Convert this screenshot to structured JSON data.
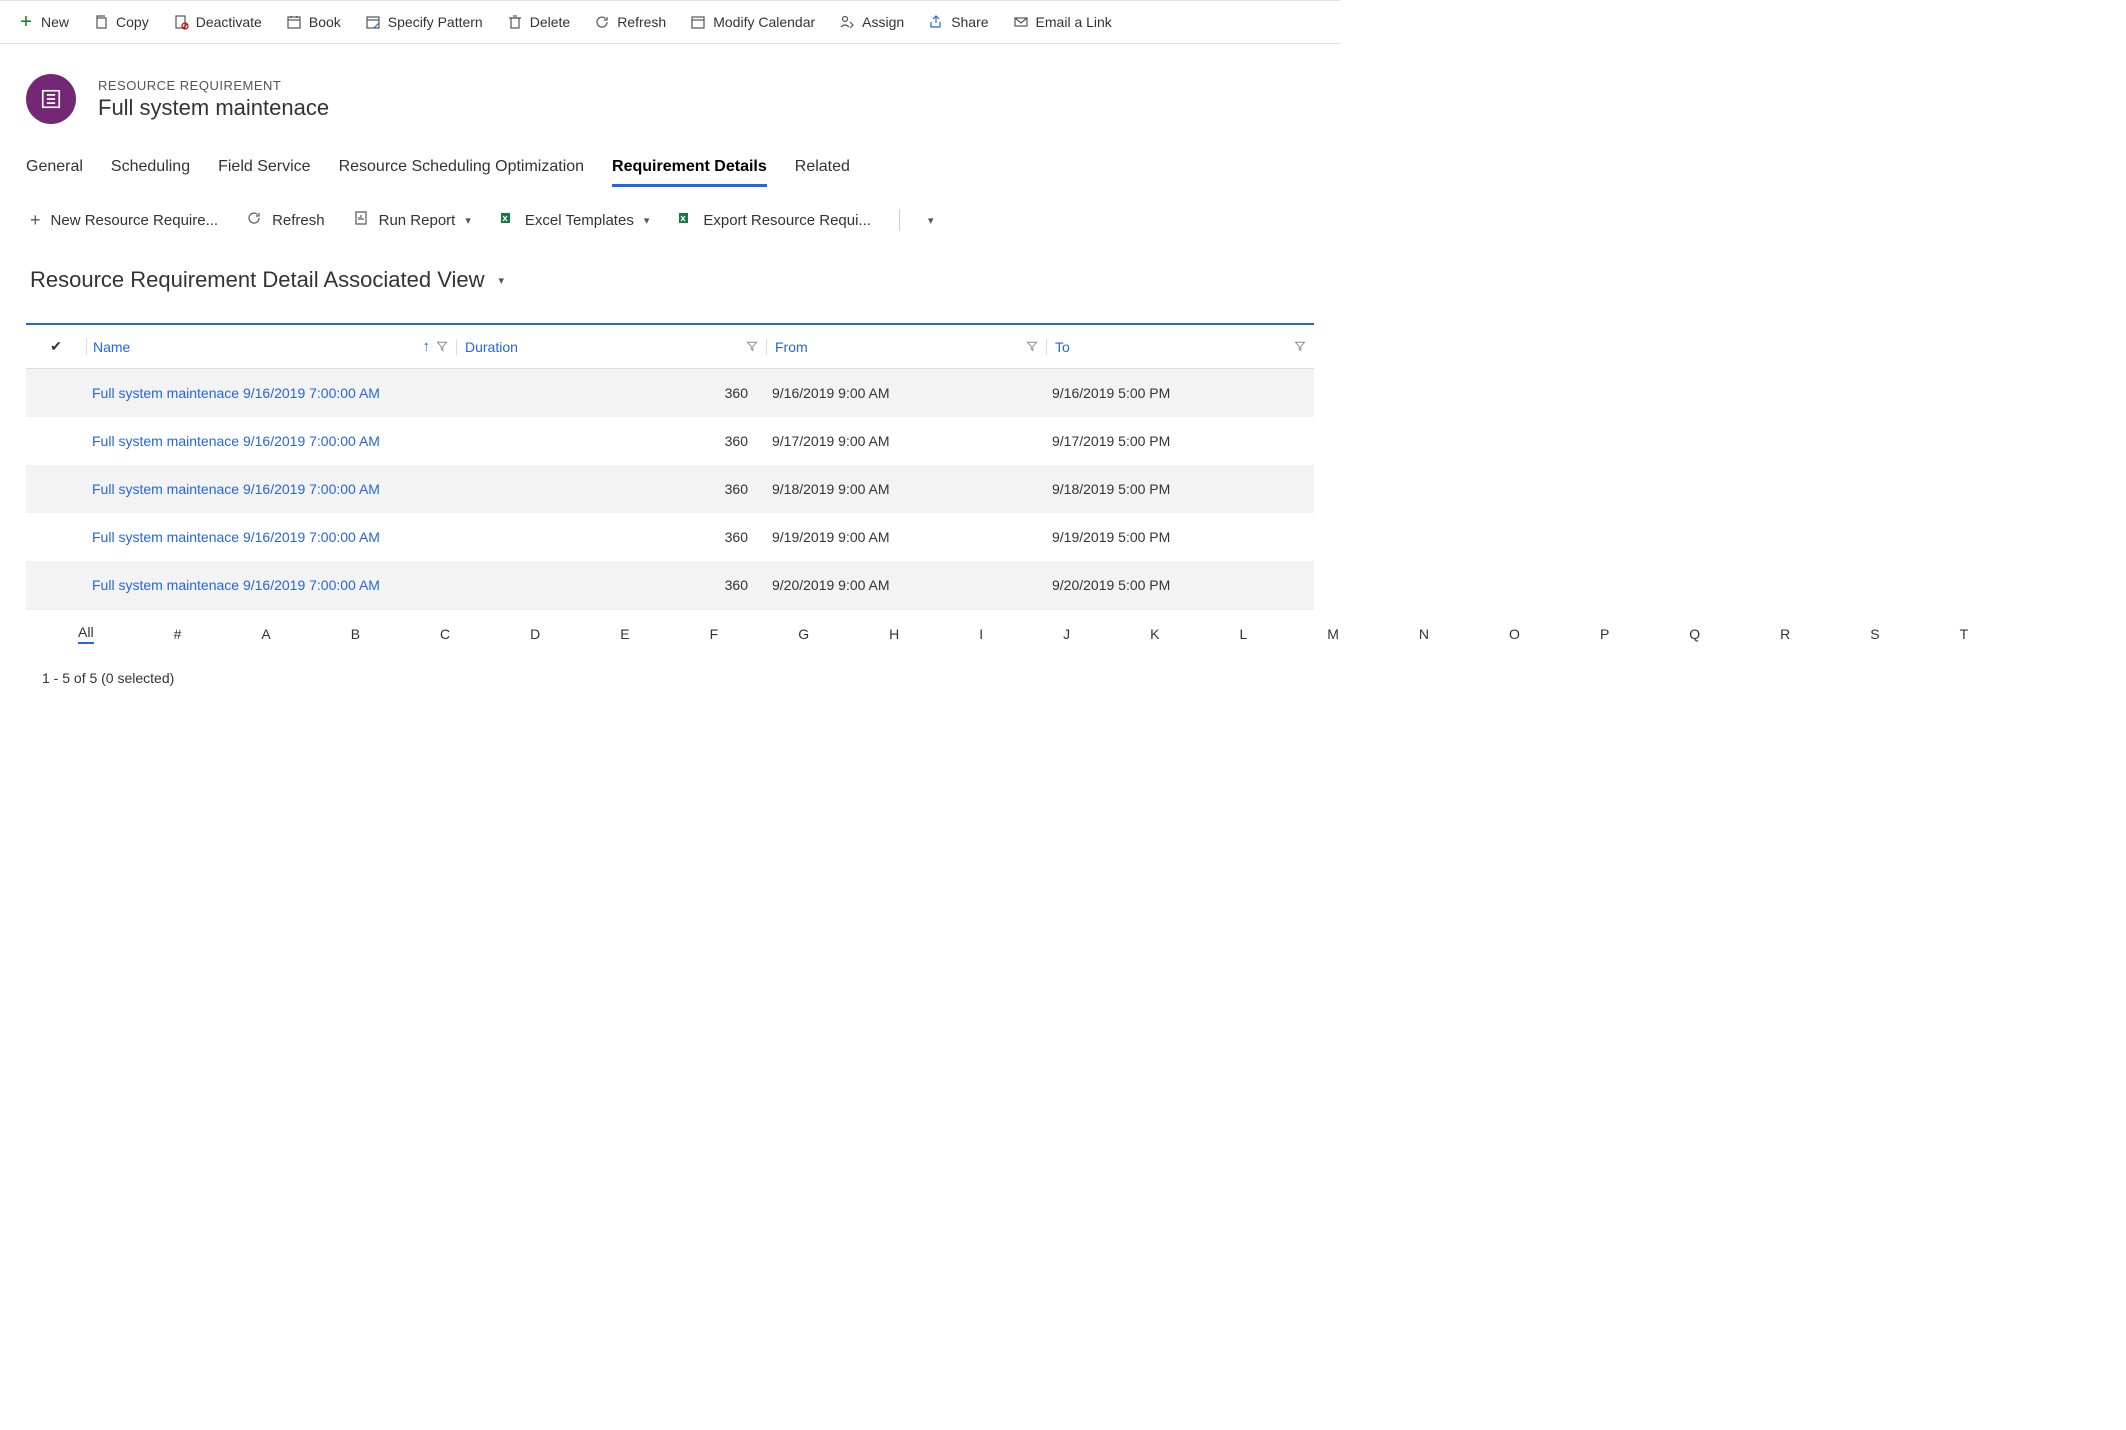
{
  "commandBar": {
    "new": "New",
    "copy": "Copy",
    "deactivate": "Deactivate",
    "book": "Book",
    "specifyPattern": "Specify Pattern",
    "delete": "Delete",
    "refresh": "Refresh",
    "modifyCalendar": "Modify Calendar",
    "assign": "Assign",
    "share": "Share",
    "emailLink": "Email a Link"
  },
  "header": {
    "entityLabel": "RESOURCE REQUIREMENT",
    "title": "Full system maintenace"
  },
  "tabs": [
    {
      "label": "General",
      "active": false
    },
    {
      "label": "Scheduling",
      "active": false
    },
    {
      "label": "Field Service",
      "active": false
    },
    {
      "label": "Resource Scheduling Optimization",
      "active": false
    },
    {
      "label": "Requirement Details",
      "active": true
    },
    {
      "label": "Related",
      "active": false
    }
  ],
  "subCommandBar": {
    "newRecord": "New Resource Require...",
    "refresh": "Refresh",
    "runReport": "Run Report",
    "excelTemplates": "Excel Templates",
    "exportRecords": "Export Resource Requi..."
  },
  "view": {
    "title": "Resource Requirement Detail Associated View"
  },
  "grid": {
    "columns": {
      "name": "Name",
      "duration": "Duration",
      "from": "From",
      "to": "To"
    },
    "rows": [
      {
        "name": "Full system maintenace 9/16/2019 7:00:00 AM",
        "duration": "360",
        "from": "9/16/2019 9:00 AM",
        "to": "9/16/2019 5:00 PM"
      },
      {
        "name": "Full system maintenace 9/16/2019 7:00:00 AM",
        "duration": "360",
        "from": "9/17/2019 9:00 AM",
        "to": "9/17/2019 5:00 PM"
      },
      {
        "name": "Full system maintenace 9/16/2019 7:00:00 AM",
        "duration": "360",
        "from": "9/18/2019 9:00 AM",
        "to": "9/18/2019 5:00 PM"
      },
      {
        "name": "Full system maintenace 9/16/2019 7:00:00 AM",
        "duration": "360",
        "from": "9/19/2019 9:00 AM",
        "to": "9/19/2019 5:00 PM"
      },
      {
        "name": "Full system maintenace 9/16/2019 7:00:00 AM",
        "duration": "360",
        "from": "9/20/2019 9:00 AM",
        "to": "9/20/2019 5:00 PM"
      }
    ]
  },
  "alpha": {
    "all": "All",
    "letters": [
      "#",
      "A",
      "B",
      "C",
      "D",
      "E",
      "F",
      "G",
      "H",
      "I",
      "J",
      "K",
      "L",
      "M",
      "N",
      "O",
      "P",
      "Q",
      "R",
      "S",
      "T"
    ]
  },
  "status": {
    "text": "1 - 5 of 5 (0 selected)"
  }
}
